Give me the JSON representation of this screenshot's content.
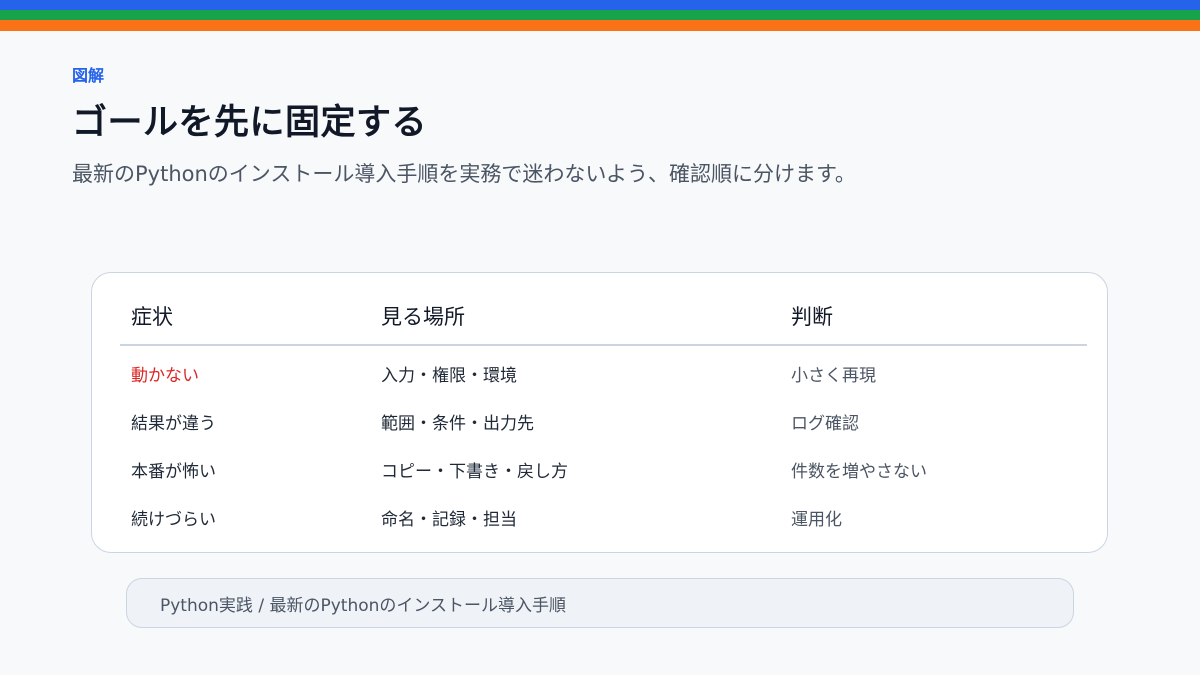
{
  "colors": {
    "stripe_blue": "#2563eb",
    "stripe_green": "#16a34a",
    "stripe_orange": "#f97316",
    "accent": "#2563eb",
    "alert": "#dc2626"
  },
  "header": {
    "eyebrow": "図解",
    "title": "ゴールを先に固定する",
    "subtitle": "最新のPythonのインストール導入手順を実務で迷わないよう、確認順に分けます。"
  },
  "table": {
    "headers": [
      "症状",
      "見る場所",
      "判断"
    ],
    "rows": [
      {
        "symptom": "動かない",
        "where": "入力・権限・環境",
        "judgment": "小さく再現",
        "alert": true
      },
      {
        "symptom": "結果が違う",
        "where": "範囲・条件・出力先",
        "judgment": "ログ確認",
        "alert": false
      },
      {
        "symptom": "本番が怖い",
        "where": "コピー・下書き・戻し方",
        "judgment": "件数を増やさない",
        "alert": false
      },
      {
        "symptom": "続けづらい",
        "where": "命名・記録・担当",
        "judgment": "運用化",
        "alert": false
      }
    ]
  },
  "footer": {
    "breadcrumb": "Python実践 / 最新のPythonのインストール導入手順"
  }
}
